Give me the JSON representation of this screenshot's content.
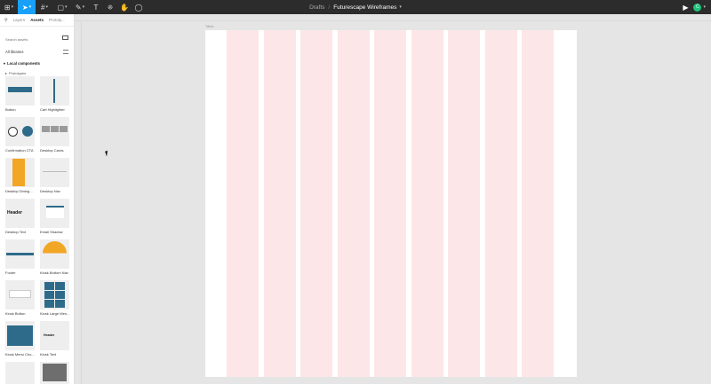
{
  "toolbar": {
    "tools": [
      {
        "name": "main-menu-icon",
        "glyph": "⊞"
      },
      {
        "name": "move-tool-icon",
        "glyph": "➤"
      },
      {
        "name": "frame-tool-icon",
        "glyph": "#"
      },
      {
        "name": "shape-tool-icon",
        "glyph": "▢"
      },
      {
        "name": "pen-tool-icon",
        "glyph": "✎"
      },
      {
        "name": "text-tool-icon",
        "glyph": "T"
      },
      {
        "name": "resources-tool-icon",
        "glyph": "⁜"
      },
      {
        "name": "hand-tool-icon",
        "glyph": "✋"
      },
      {
        "name": "comment-tool-icon",
        "glyph": "◯"
      }
    ],
    "breadcrumb": "Drafts",
    "separator": "/",
    "file_name": "Futurescape Wireframes",
    "avatar_initial": "C",
    "play_glyph": "▶"
  },
  "panel": {
    "tabs": [
      "Layers",
      "Assets",
      "Prototy..."
    ],
    "search_placeholder": "Search assets",
    "all_libraries": "All libraries",
    "local_components": "Local components",
    "prototypes": "Prototypes",
    "components": [
      {
        "label": "Button",
        "thumb": "button"
      },
      {
        "label": "Cart Highlighter",
        "thumb": "bar"
      },
      {
        "label": "Confirmation CTA",
        "thumb": "circles"
      },
      {
        "label": "Desktop Cards",
        "thumb": "cards"
      },
      {
        "label": "Desktop Dining ...",
        "thumb": "orange"
      },
      {
        "label": "Desktop Nav",
        "thumb": "nav"
      },
      {
        "label": "Desktop Text",
        "thumb": "header",
        "thumb_text": "Header"
      },
      {
        "label": "Email Shadow",
        "thumb": "email"
      },
      {
        "label": "Footer",
        "thumb": "footer"
      },
      {
        "label": "Kiosk Bottom Nav",
        "thumb": "semicircle"
      },
      {
        "label": "Kiosk Button",
        "thumb": "kbutton"
      },
      {
        "label": "Kiosk Large Men...",
        "thumb": "kgrid"
      },
      {
        "label": "Kiosk Menu Cho...",
        "thumb": "kmenu"
      },
      {
        "label": "Kiosk Text",
        "thumb": "ktext",
        "thumb_text": "Header"
      },
      {
        "label": "",
        "thumb": "blank"
      },
      {
        "label": "",
        "thumb": "photo"
      }
    ]
  },
  "canvas": {
    "frame_label": "Table",
    "column_count": 9,
    "column_color": "#fde6e8",
    "background": "#e5e5e5"
  },
  "colors": {
    "toolbar": "#2c2c2c",
    "accent": "#18a0fb",
    "avatar": "#1bc47d",
    "brand_blue": "#2e6b8a",
    "brand_orange": "#f2a626"
  }
}
